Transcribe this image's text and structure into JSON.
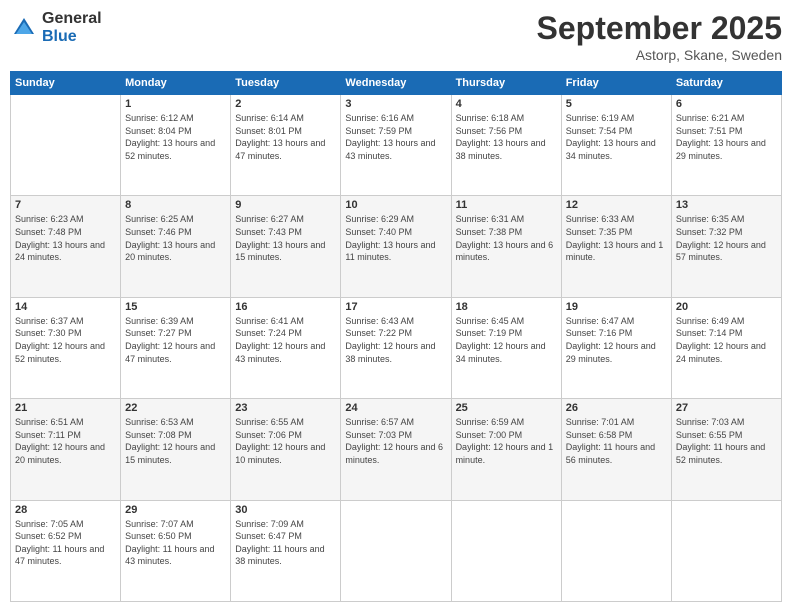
{
  "logo": {
    "general": "General",
    "blue": "Blue"
  },
  "header": {
    "month": "September 2025",
    "location": "Astorp, Skane, Sweden"
  },
  "weekdays": [
    "Sunday",
    "Monday",
    "Tuesday",
    "Wednesday",
    "Thursday",
    "Friday",
    "Saturday"
  ],
  "weeks": [
    [
      {
        "day": "",
        "sunrise": "",
        "sunset": "",
        "daylight": ""
      },
      {
        "day": "1",
        "sunrise": "Sunrise: 6:12 AM",
        "sunset": "Sunset: 8:04 PM",
        "daylight": "Daylight: 13 hours and 52 minutes."
      },
      {
        "day": "2",
        "sunrise": "Sunrise: 6:14 AM",
        "sunset": "Sunset: 8:01 PM",
        "daylight": "Daylight: 13 hours and 47 minutes."
      },
      {
        "day": "3",
        "sunrise": "Sunrise: 6:16 AM",
        "sunset": "Sunset: 7:59 PM",
        "daylight": "Daylight: 13 hours and 43 minutes."
      },
      {
        "day": "4",
        "sunrise": "Sunrise: 6:18 AM",
        "sunset": "Sunset: 7:56 PM",
        "daylight": "Daylight: 13 hours and 38 minutes."
      },
      {
        "day": "5",
        "sunrise": "Sunrise: 6:19 AM",
        "sunset": "Sunset: 7:54 PM",
        "daylight": "Daylight: 13 hours and 34 minutes."
      },
      {
        "day": "6",
        "sunrise": "Sunrise: 6:21 AM",
        "sunset": "Sunset: 7:51 PM",
        "daylight": "Daylight: 13 hours and 29 minutes."
      }
    ],
    [
      {
        "day": "7",
        "sunrise": "Sunrise: 6:23 AM",
        "sunset": "Sunset: 7:48 PM",
        "daylight": "Daylight: 13 hours and 24 minutes."
      },
      {
        "day": "8",
        "sunrise": "Sunrise: 6:25 AM",
        "sunset": "Sunset: 7:46 PM",
        "daylight": "Daylight: 13 hours and 20 minutes."
      },
      {
        "day": "9",
        "sunrise": "Sunrise: 6:27 AM",
        "sunset": "Sunset: 7:43 PM",
        "daylight": "Daylight: 13 hours and 15 minutes."
      },
      {
        "day": "10",
        "sunrise": "Sunrise: 6:29 AM",
        "sunset": "Sunset: 7:40 PM",
        "daylight": "Daylight: 13 hours and 11 minutes."
      },
      {
        "day": "11",
        "sunrise": "Sunrise: 6:31 AM",
        "sunset": "Sunset: 7:38 PM",
        "daylight": "Daylight: 13 hours and 6 minutes."
      },
      {
        "day": "12",
        "sunrise": "Sunrise: 6:33 AM",
        "sunset": "Sunset: 7:35 PM",
        "daylight": "Daylight: 13 hours and 1 minute."
      },
      {
        "day": "13",
        "sunrise": "Sunrise: 6:35 AM",
        "sunset": "Sunset: 7:32 PM",
        "daylight": "Daylight: 12 hours and 57 minutes."
      }
    ],
    [
      {
        "day": "14",
        "sunrise": "Sunrise: 6:37 AM",
        "sunset": "Sunset: 7:30 PM",
        "daylight": "Daylight: 12 hours and 52 minutes."
      },
      {
        "day": "15",
        "sunrise": "Sunrise: 6:39 AM",
        "sunset": "Sunset: 7:27 PM",
        "daylight": "Daylight: 12 hours and 47 minutes."
      },
      {
        "day": "16",
        "sunrise": "Sunrise: 6:41 AM",
        "sunset": "Sunset: 7:24 PM",
        "daylight": "Daylight: 12 hours and 43 minutes."
      },
      {
        "day": "17",
        "sunrise": "Sunrise: 6:43 AM",
        "sunset": "Sunset: 7:22 PM",
        "daylight": "Daylight: 12 hours and 38 minutes."
      },
      {
        "day": "18",
        "sunrise": "Sunrise: 6:45 AM",
        "sunset": "Sunset: 7:19 PM",
        "daylight": "Daylight: 12 hours and 34 minutes."
      },
      {
        "day": "19",
        "sunrise": "Sunrise: 6:47 AM",
        "sunset": "Sunset: 7:16 PM",
        "daylight": "Daylight: 12 hours and 29 minutes."
      },
      {
        "day": "20",
        "sunrise": "Sunrise: 6:49 AM",
        "sunset": "Sunset: 7:14 PM",
        "daylight": "Daylight: 12 hours and 24 minutes."
      }
    ],
    [
      {
        "day": "21",
        "sunrise": "Sunrise: 6:51 AM",
        "sunset": "Sunset: 7:11 PM",
        "daylight": "Daylight: 12 hours and 20 minutes."
      },
      {
        "day": "22",
        "sunrise": "Sunrise: 6:53 AM",
        "sunset": "Sunset: 7:08 PM",
        "daylight": "Daylight: 12 hours and 15 minutes."
      },
      {
        "day": "23",
        "sunrise": "Sunrise: 6:55 AM",
        "sunset": "Sunset: 7:06 PM",
        "daylight": "Daylight: 12 hours and 10 minutes."
      },
      {
        "day": "24",
        "sunrise": "Sunrise: 6:57 AM",
        "sunset": "Sunset: 7:03 PM",
        "daylight": "Daylight: 12 hours and 6 minutes."
      },
      {
        "day": "25",
        "sunrise": "Sunrise: 6:59 AM",
        "sunset": "Sunset: 7:00 PM",
        "daylight": "Daylight: 12 hours and 1 minute."
      },
      {
        "day": "26",
        "sunrise": "Sunrise: 7:01 AM",
        "sunset": "Sunset: 6:58 PM",
        "daylight": "Daylight: 11 hours and 56 minutes."
      },
      {
        "day": "27",
        "sunrise": "Sunrise: 7:03 AM",
        "sunset": "Sunset: 6:55 PM",
        "daylight": "Daylight: 11 hours and 52 minutes."
      }
    ],
    [
      {
        "day": "28",
        "sunrise": "Sunrise: 7:05 AM",
        "sunset": "Sunset: 6:52 PM",
        "daylight": "Daylight: 11 hours and 47 minutes."
      },
      {
        "day": "29",
        "sunrise": "Sunrise: 7:07 AM",
        "sunset": "Sunset: 6:50 PM",
        "daylight": "Daylight: 11 hours and 43 minutes."
      },
      {
        "day": "30",
        "sunrise": "Sunrise: 7:09 AM",
        "sunset": "Sunset: 6:47 PM",
        "daylight": "Daylight: 11 hours and 38 minutes."
      },
      {
        "day": "",
        "sunrise": "",
        "sunset": "",
        "daylight": ""
      },
      {
        "day": "",
        "sunrise": "",
        "sunset": "",
        "daylight": ""
      },
      {
        "day": "",
        "sunrise": "",
        "sunset": "",
        "daylight": ""
      },
      {
        "day": "",
        "sunrise": "",
        "sunset": "",
        "daylight": ""
      }
    ]
  ]
}
